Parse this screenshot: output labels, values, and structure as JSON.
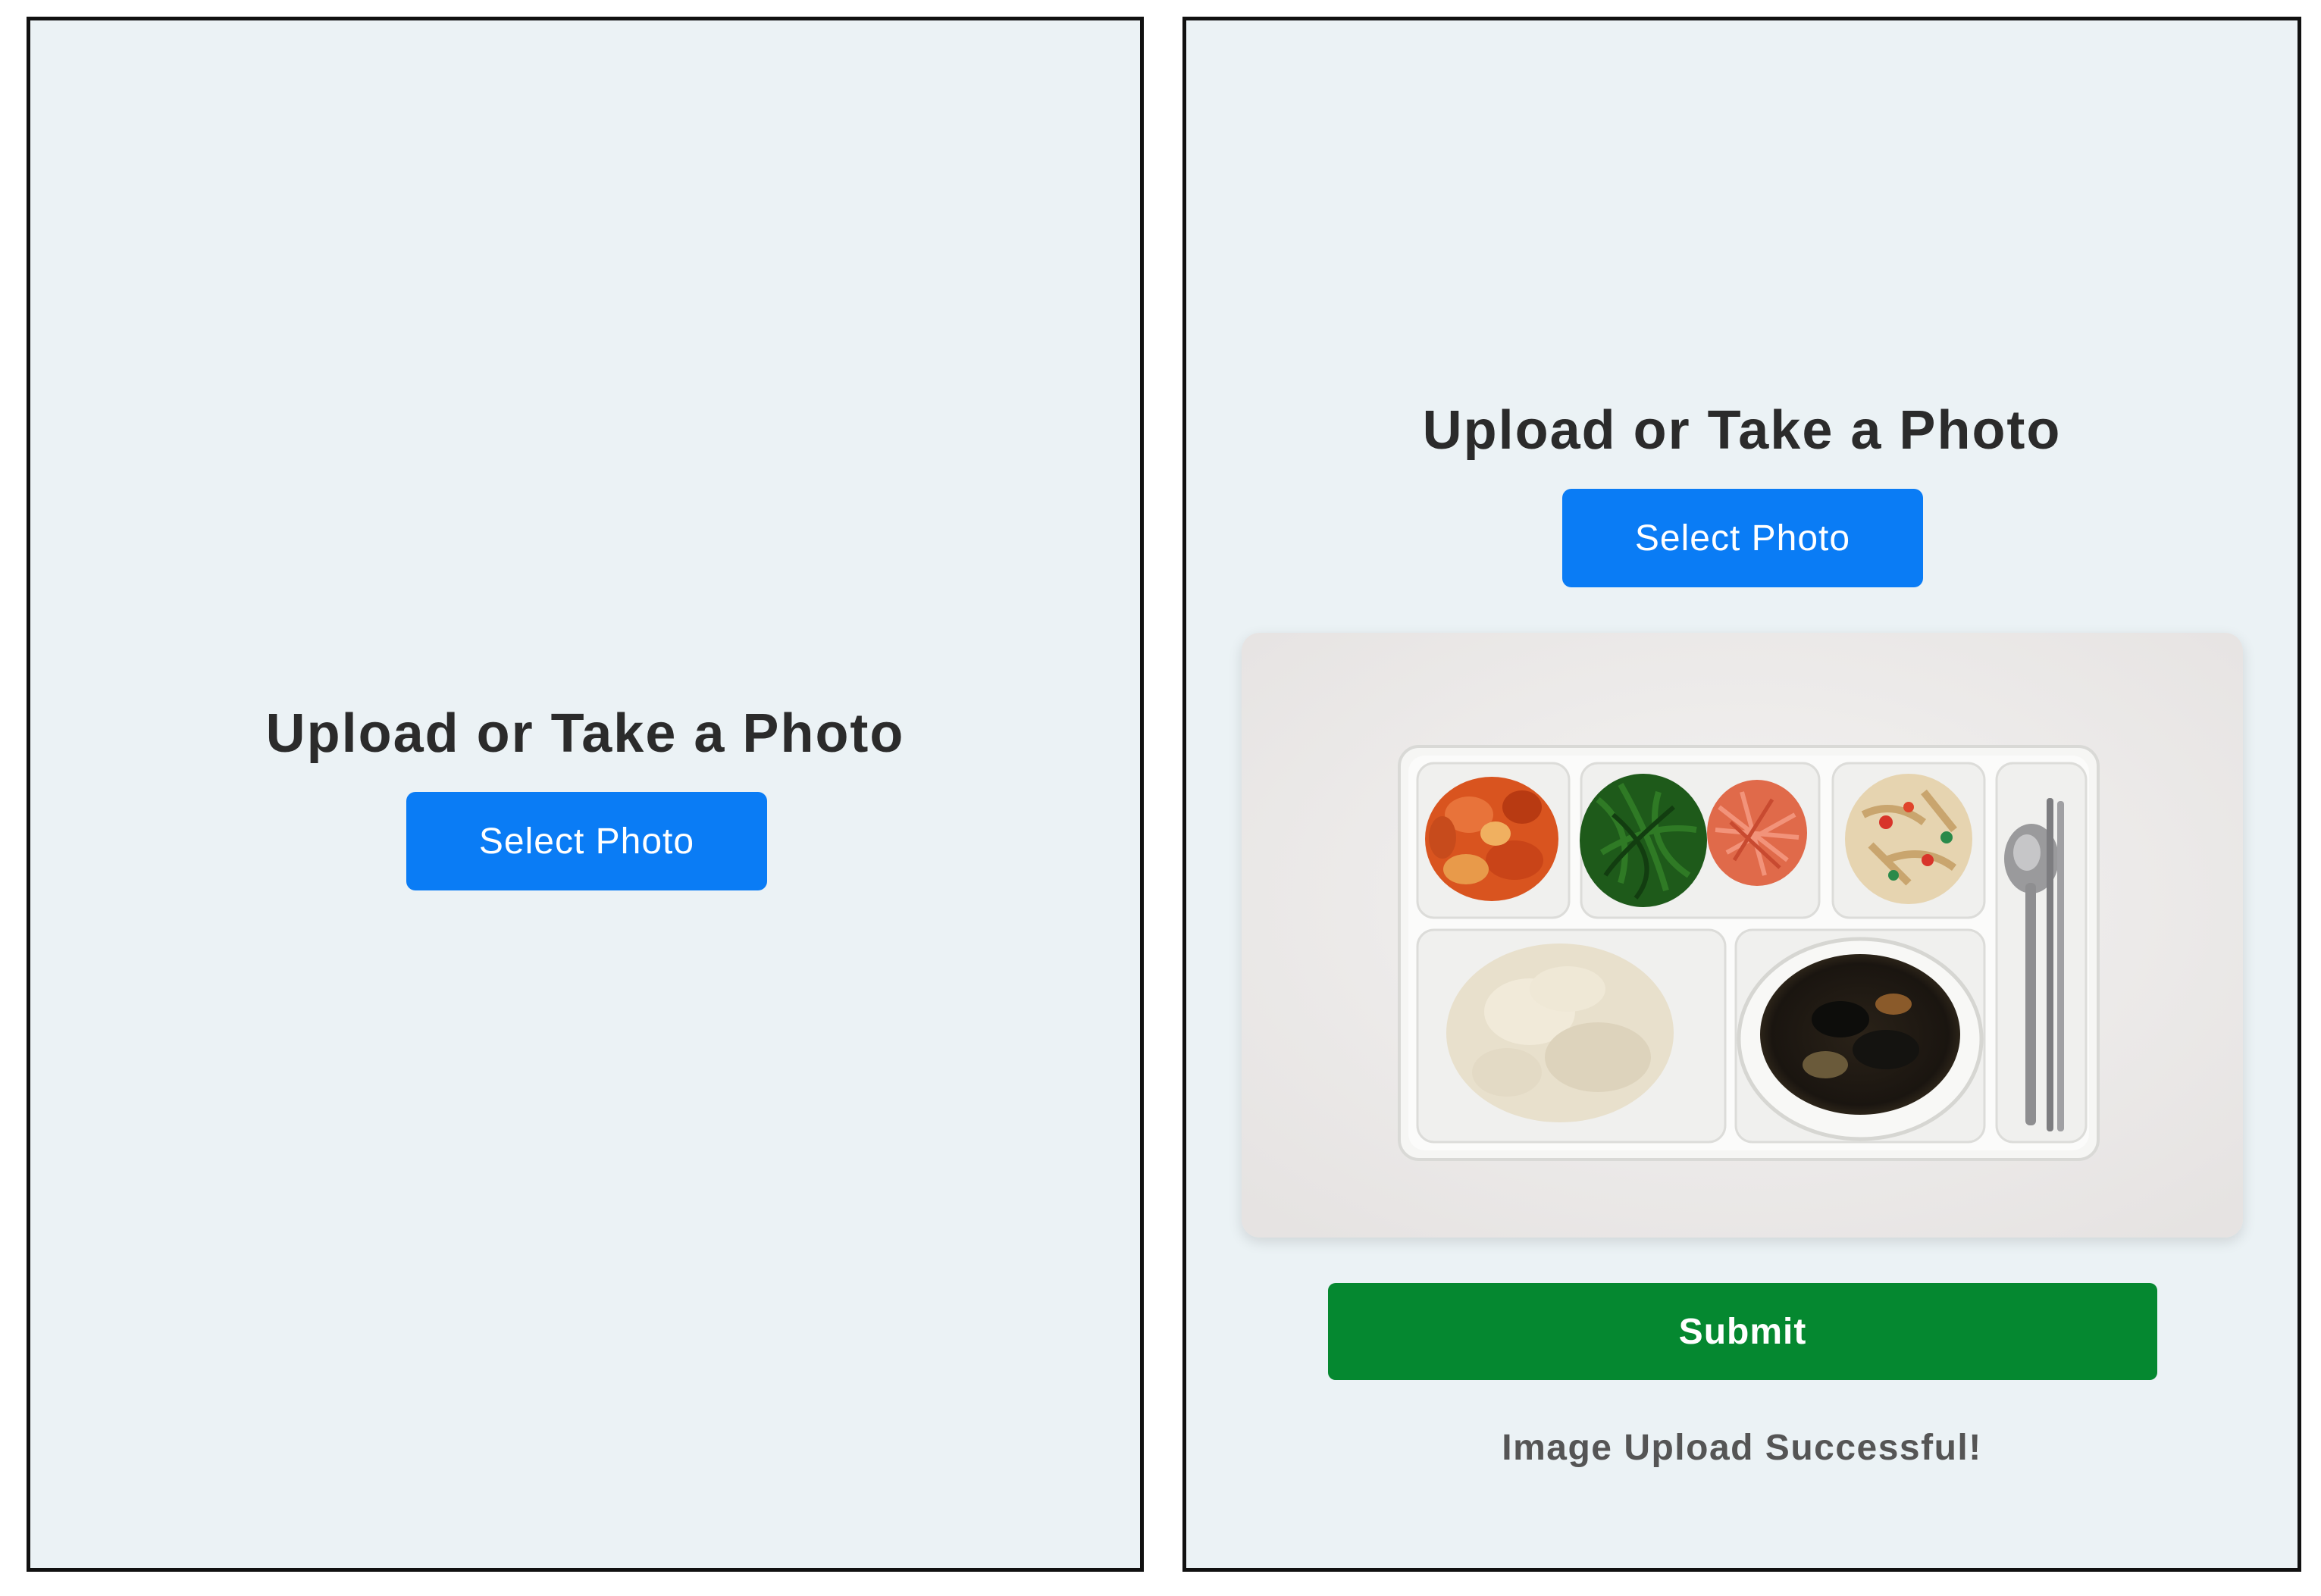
{
  "screens": {
    "before": {
      "title": "Upload or Take a Photo",
      "select_button_label": "Select Photo"
    },
    "after": {
      "title": "Upload or Take a Photo",
      "select_button_label": "Select Photo",
      "preview_image": "meal-tray-photo",
      "submit_button_label": "Submit",
      "status_message": "Image Upload Successful!"
    }
  },
  "colors": {
    "background": "#ebf2f5",
    "primary_button": "#0a7cf5",
    "submit_button": "#058830",
    "heading_text": "#2b2b2b",
    "status_text": "#555555"
  }
}
